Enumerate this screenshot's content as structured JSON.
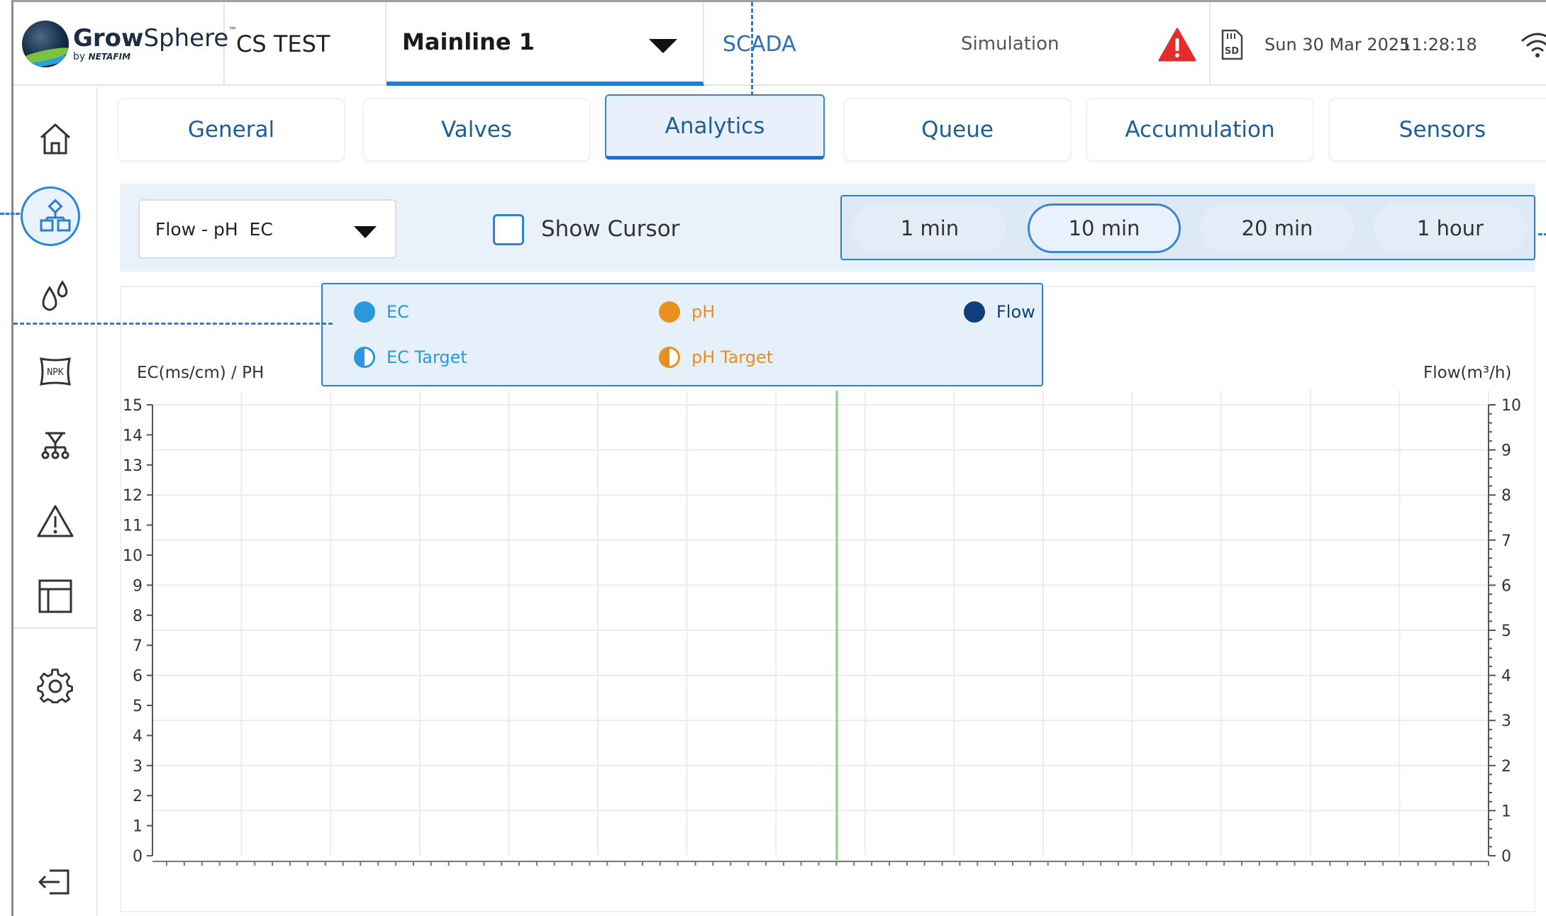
{
  "header": {
    "logo_main_bold": "Grow",
    "logo_main_light": "Sphere",
    "logo_tm": "™",
    "logo_sub_by": "by",
    "logo_sub_brand": "NETAFIM",
    "site_name": "CS TEST",
    "mainline": "Mainline 1",
    "scada": "SCADA",
    "simulation": "Simulation",
    "sd_label": "SD",
    "date": "Sun 30 Mar 2025",
    "time": "11:28:18"
  },
  "sidebar": {
    "items": [
      {
        "name": "home-icon"
      },
      {
        "name": "irrigation-system-icon",
        "active": true
      },
      {
        "name": "water-drops-icon"
      },
      {
        "name": "npk-fertilizer-icon"
      },
      {
        "name": "valve-network-icon"
      },
      {
        "name": "warning-icon"
      },
      {
        "name": "table-layout-icon"
      },
      {
        "name": "settings-gear-icon"
      },
      {
        "name": "logout-icon"
      }
    ]
  },
  "tabs": [
    {
      "label": "General"
    },
    {
      "label": "Valves"
    },
    {
      "label": "Analytics",
      "active": true
    },
    {
      "label": "Queue"
    },
    {
      "label": "Accumulation"
    },
    {
      "label": "Sensors"
    }
  ],
  "toolbar": {
    "select_value": "Flow - pH  EC",
    "show_cursor_label": "Show Cursor",
    "show_cursor_checked": false,
    "ranges": [
      "1 min",
      "10 min",
      "20 min",
      "1 hour"
    ],
    "selected_range": "10 min"
  },
  "legend": {
    "ec": "EC",
    "ph": "pH",
    "flow": "Flow",
    "ec_target": "EC Target",
    "ph_target": "pH Target"
  },
  "colors": {
    "ec": "#2a98dc",
    "ph": "#e8901e",
    "flow": "#0f3f7a",
    "accent": "#2b7fd4",
    "cursor_line": "#7fd47f"
  },
  "chart_data": {
    "type": "line",
    "ylabel_left": "EC(ms/cm) / PH",
    "ylabel_right": "Flow(m³/h)",
    "ylim_left": [
      0,
      15
    ],
    "ylim_right": [
      0,
      10
    ],
    "left_ticks": [
      "15",
      "14",
      "13",
      "12",
      "11",
      "10",
      "9",
      "8",
      "7",
      "6",
      "5",
      "4",
      "3",
      "2",
      "1",
      "0"
    ],
    "right_ticks": [
      "10",
      "9",
      "8",
      "7",
      "6",
      "5",
      "4",
      "3",
      "2",
      "1",
      "0"
    ],
    "series": [
      {
        "name": "EC",
        "values": []
      },
      {
        "name": "pH",
        "values": []
      },
      {
        "name": "Flow",
        "values": []
      },
      {
        "name": "EC Target",
        "values": []
      },
      {
        "name": "pH Target",
        "values": []
      }
    ],
    "grid": true
  }
}
